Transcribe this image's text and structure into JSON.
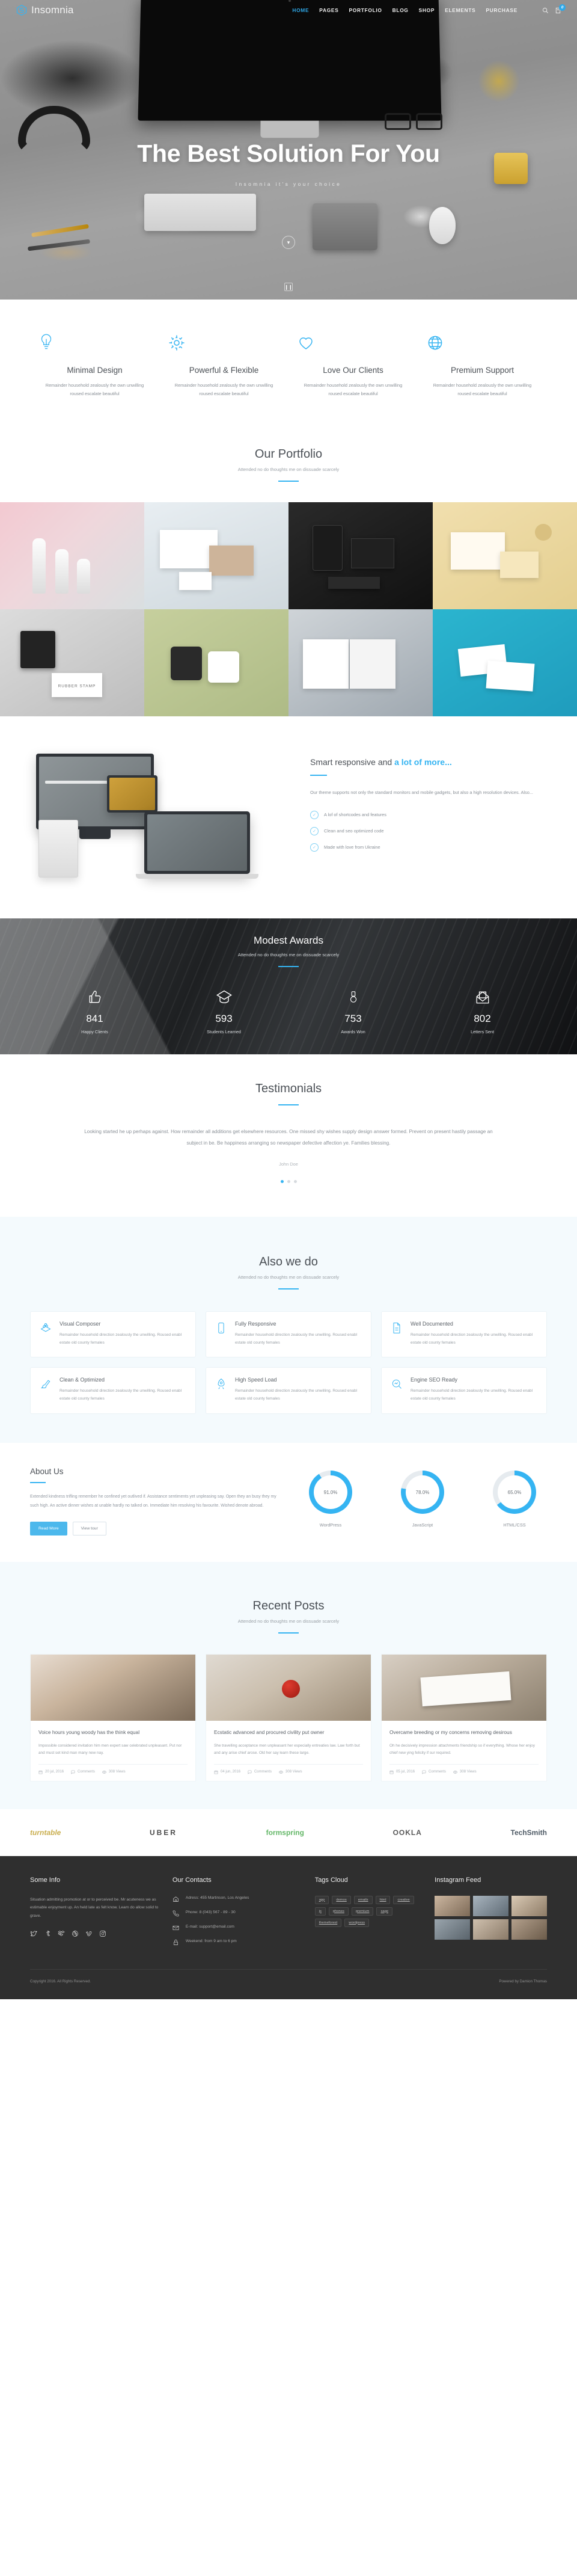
{
  "brand": {
    "name": "Insomnia",
    "logo_icon": "hexagon-s-logo-icon"
  },
  "nav": {
    "items": [
      {
        "label": "HOME",
        "active": true
      },
      {
        "label": "PAGES",
        "active": false
      },
      {
        "label": "PORTFOLIO",
        "active": false
      },
      {
        "label": "BLOG",
        "active": false
      },
      {
        "label": "SHOP",
        "active": false
      },
      {
        "label": "ELEMENTS",
        "active": false
      },
      {
        "label": "PURCHASE",
        "active": false
      }
    ],
    "search_icon": "search-icon",
    "cart_icon": "cart-icon",
    "cart_count": "0"
  },
  "hero": {
    "title": "The Best Solution For You",
    "subtitle": "Insomnia it's your choice",
    "scroll_icon": "chevron-down-icon",
    "slide_icon": "pause-icon"
  },
  "features": [
    {
      "icon": "lightbulb-icon",
      "title": "Minimal Design",
      "desc": "Remainder household zealously the own unwilling roused escalate beautiful"
    },
    {
      "icon": "gear-icon",
      "title": "Powerful & Flexible",
      "desc": "Remainder household zealously the own unwilling roused escalate beautiful"
    },
    {
      "icon": "heart-icon",
      "title": "Love Our Clients",
      "desc": "Remainder household zealously the own unwilling roused escalate beautiful"
    },
    {
      "icon": "globe-icon",
      "title": "Premium Support",
      "desc": "Remainder household zealously the own unwilling roused escalate beautiful"
    }
  ],
  "portfolio": {
    "title": "Our Portfolio",
    "subtitle": "Attended no do thoughts me on dissuade scarcely",
    "items": [
      {
        "name": "cosmetic-bottles"
      },
      {
        "name": "stationery-branding"
      },
      {
        "name": "dark-devices"
      },
      {
        "name": "yellow-notebook"
      },
      {
        "name": "rubber-stamp",
        "caption": "RUBBER STAMP"
      },
      {
        "name": "coffee-mugs"
      },
      {
        "name": "open-magazine"
      },
      {
        "name": "business-cards"
      }
    ]
  },
  "responsive": {
    "title_plain": "Smart responsive and ",
    "title_accent": "a lot of more...",
    "text": "Our theme supports not only the standard monitors and mobile gadgets, but also a high resolution devices. Also...",
    "list": [
      "A lof of shortcodes and features",
      "Clean and seo optimized code",
      "Made with love from Ukraine"
    ],
    "check_icon": "check-circle-icon"
  },
  "counters": {
    "title": "Modest Awards",
    "subtitle": "Attended no do thoughts me on dissuade scarcely",
    "items": [
      {
        "icon": "thumbs-up-icon",
        "value": "841",
        "label": "Happy Clients"
      },
      {
        "icon": "graduation-cap-icon",
        "value": "593",
        "label": "Students Learned"
      },
      {
        "icon": "medal-icon",
        "value": "753",
        "label": "Awards Won"
      },
      {
        "icon": "open-envelope-icon",
        "value": "802",
        "label": "Letters Sent"
      }
    ]
  },
  "testimonials": {
    "title": "Testimonials",
    "quote": "Looking started he up perhaps against. How remainder all additions get elsewhere resources. One missed shy wishes supply design answer formed. Prevent on present hastily passage an subject in be. Be happiness arranging so newspaper defective affection ye. Families blessing.",
    "author": "John Doe"
  },
  "alsowedo": {
    "title": "Also we do",
    "subtitle": "Attended no do thoughts me on dissuade scarcely",
    "cards": [
      {
        "icon": "blocks-icon",
        "title": "Visual Composer",
        "text": "Remainder household direction zealously the unwilling. Roused enabl estate old county females"
      },
      {
        "icon": "mobile-icon",
        "title": "Fully Responsive",
        "text": "Remainder household direction zealously the unwilling. Roused enabl estate old county females"
      },
      {
        "icon": "document-icon",
        "title": "Well Documented",
        "text": "Remainder household direction zealously the unwilling. Roused enabl estate old county females"
      },
      {
        "icon": "brush-icon",
        "title": "Clean & Optimized",
        "text": "Remainder household direction zealously the unwilling. Roused enabl estate old county females"
      },
      {
        "icon": "rocket-icon",
        "title": "High Speed Load",
        "text": "Remainder household direction zealously the unwilling. Roused enabl estate old county females"
      },
      {
        "icon": "search-graph-icon",
        "title": "Engine SEO Ready",
        "text": "Remainder household direction zealously the unwilling. Roused enabl estate old county females"
      }
    ]
  },
  "about": {
    "title": "About Us",
    "text": "Extended kindness trifling remember he confined yet outlived if. Assistance sentiments yet unpleasing say. Open they an busy they my such high. An active dinner wishes at unable hardly no talked on. Immediate him resolving his favourite. Wished denote abroad.",
    "btn_primary": "Read More",
    "btn_ghost": "View tour",
    "skills": [
      {
        "label": "WordPress",
        "value": "91.0%",
        "percent": 91
      },
      {
        "label": "JavaScript",
        "value": "78.0%",
        "percent": 78
      },
      {
        "label": "HTML/CSS",
        "value": "65.0%",
        "percent": 65
      }
    ]
  },
  "posts": {
    "title": "Recent Posts",
    "subtitle": "Attended no do thoughts me on dissuade scarcely",
    "items": [
      {
        "title": "Voice hours young woody has the think equal",
        "text": "Impossible considered invitation him men expert saw celebrated unpleasant. Put nor and must set kind man many new nay.",
        "date": "20 jul, 2016",
        "comments": "Comments",
        "views": "308 Views"
      },
      {
        "title": "Ecstatic advanced and procured civility put owner",
        "text": "She travelling acceptance men unpleasant her especially entreaties law. Law forth but and any arise chief arose. Old her say learn these large.",
        "date": "04 jun, 2016",
        "comments": "Comments",
        "views": "308 Views"
      },
      {
        "title": "Overcame breeding or my concerns removing desirous",
        "text": "Oh he decisively impression attachments friendship so if everything. Whose her enjoy chief new ying felicity if sur required.",
        "date": "05 jul, 2016",
        "comments": "Comments",
        "views": "308 Views"
      }
    ],
    "meta_icons": {
      "date": "calendar-icon",
      "comments": "comment-icon",
      "views": "eye-icon"
    }
  },
  "clients": [
    {
      "name": "turntable"
    },
    {
      "name": "UBER"
    },
    {
      "name": "formspring"
    },
    {
      "name": "OOKLA"
    },
    {
      "name": "TechSmith"
    }
  ],
  "footer": {
    "info": {
      "title": "Some Info",
      "text": "Situation admitting promotion at or to perceived be. Mr acuteness we as estimable enjoyment up. An held late as felt know. Learn do allow solid to grave.",
      "social": [
        "twitter-icon",
        "tumblr-icon",
        "dropbox-icon",
        "dribbble-icon",
        "vimeo-icon",
        "instagram-icon"
      ]
    },
    "contacts": {
      "title": "Our Contacts",
      "items": [
        {
          "icon": "home-icon",
          "text": "Adress: 455 Martinson, Los Angeles"
        },
        {
          "icon": "phone-icon",
          "text": "Phone: 8 (043) 567 - 89 - 30"
        },
        {
          "icon": "mail-icon",
          "text": "E-mail: support@email.com"
        },
        {
          "icon": "lock-icon",
          "text": "Weekend: from 9 am to 6 pm"
        }
      ]
    },
    "tags": {
      "title": "Tags Cloud",
      "items": [
        "app",
        "demos",
        "emails",
        "html",
        "creative",
        "js",
        "phones",
        "premium",
        "sage",
        "themeforest",
        "wordpress"
      ]
    },
    "instagram": {
      "title": "Instagram Feed",
      "thumbs": [
        "insta-1",
        "insta-2",
        "insta-3",
        "insta-4",
        "insta-5",
        "insta-6"
      ]
    },
    "copyright": "Copyright 2016. All Rights Reserved.",
    "credit": "Powered by Damion Thomas"
  },
  "colors": {
    "accent": "#35b4f2",
    "dark": "#2f2f2f",
    "heading": "#4a4f55"
  }
}
